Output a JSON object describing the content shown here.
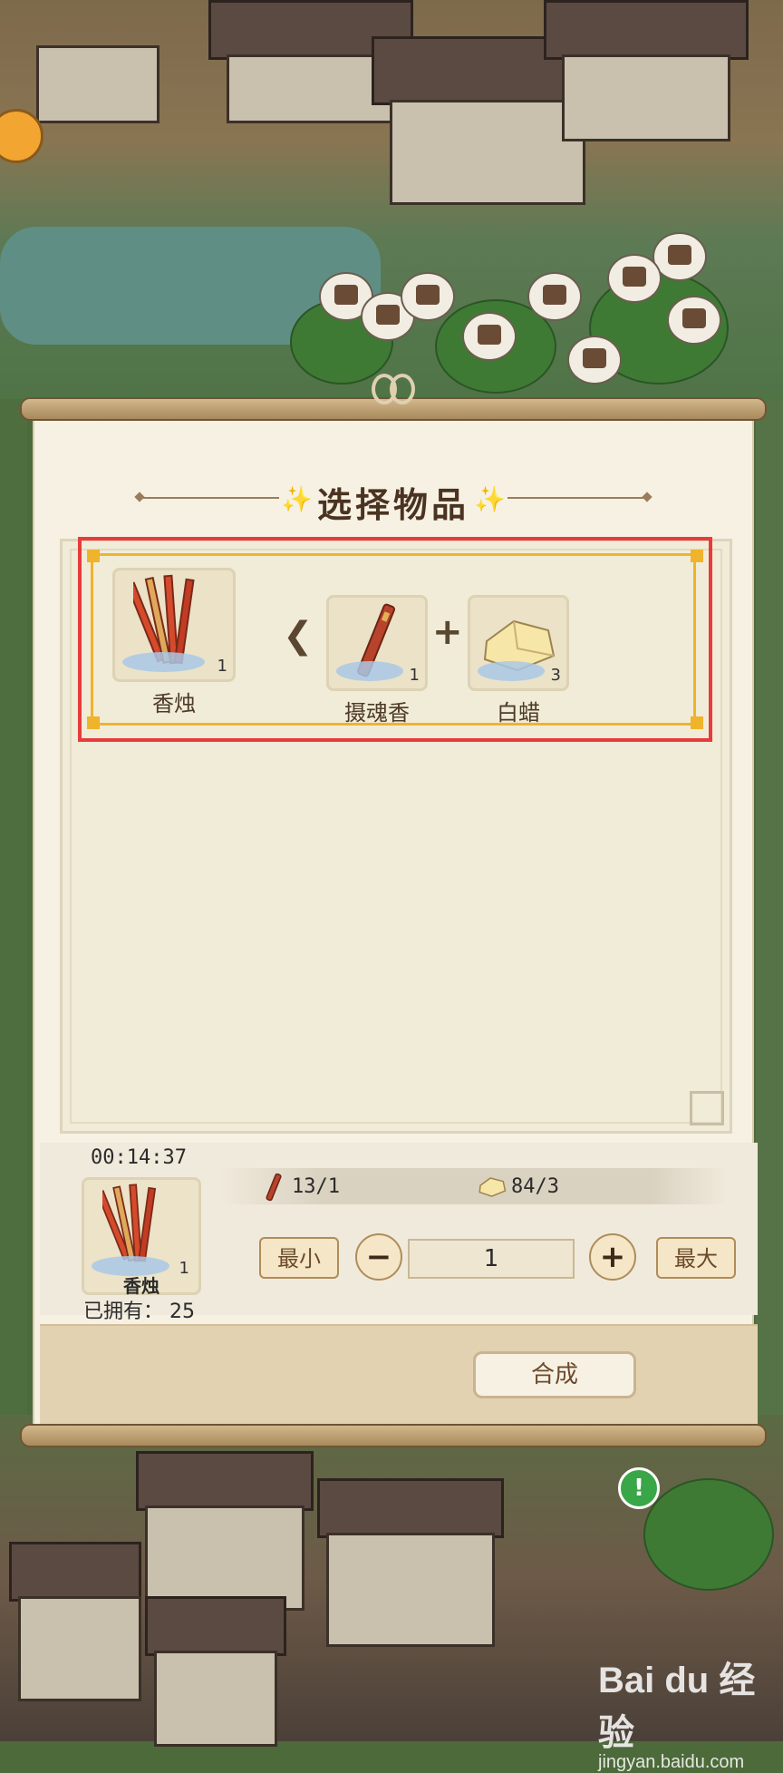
{
  "dialog": {
    "title": "选择物品"
  },
  "recipe": {
    "result": {
      "name": "香烛",
      "qty": "1",
      "icon": "incense-bundle-icon"
    },
    "ingredients": [
      {
        "name": "摄魂香",
        "qty": "1",
        "icon": "incense-stick-icon"
      },
      {
        "name": "白蜡",
        "qty": "3",
        "icon": "white-wax-icon"
      }
    ],
    "operator_plus": "+"
  },
  "craft": {
    "timer": "00:14:37",
    "result_name": "香烛",
    "result_qty": "1",
    "owned": "已拥有： 25",
    "materials": [
      {
        "icon": "incense-stick-icon",
        "value": "13/1"
      },
      {
        "icon": "white-wax-icon",
        "value": "84/3"
      }
    ],
    "min_label": "最小",
    "max_label": "最大",
    "minus_label": "−",
    "plus_label": "+",
    "quantity": "1",
    "confirm_label": "合成"
  },
  "watermark": {
    "brand": "Bai du 经验",
    "url": "jingyan.baidu.com"
  },
  "colors": {
    "highlight": "#e83b3b",
    "frame": "#f0b32c",
    "paper": "#f6f1e3"
  }
}
